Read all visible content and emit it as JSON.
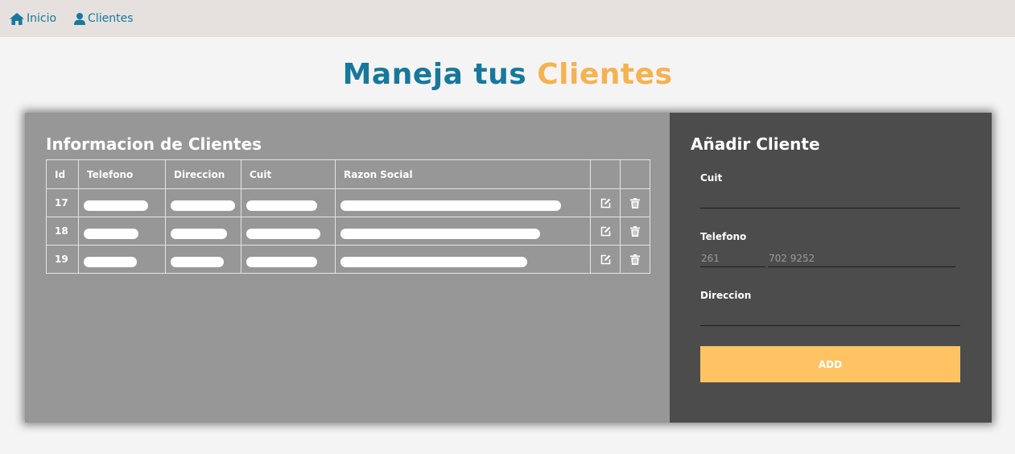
{
  "nav": {
    "items": [
      {
        "label": "Inicio",
        "icon": "home-icon"
      },
      {
        "label": "Clientes",
        "icon": "user-icon"
      }
    ]
  },
  "page": {
    "title_part1": "Maneja tus",
    "title_part2": "Clientes"
  },
  "colors": {
    "accent_blue": "#17789c",
    "accent_orange": "#f5b251",
    "button": "#ffc364",
    "table_panel": "#979797",
    "form_panel": "#4c4c4c"
  },
  "table": {
    "heading": "Informacion de Clientes",
    "columns": [
      "Id",
      "Telefono",
      "Direccion",
      "Cuit",
      "Razon Social",
      "",
      ""
    ],
    "rows": [
      {
        "id": "17",
        "telefono": "",
        "direccion": "",
        "cuit": "",
        "razon_social": "",
        "edit_icon": "edit-icon",
        "delete_icon": "trash-icon"
      },
      {
        "id": "18",
        "telefono": "",
        "direccion": "",
        "cuit": "",
        "razon_social": "",
        "edit_icon": "edit-icon",
        "delete_icon": "trash-icon"
      },
      {
        "id": "19",
        "telefono": "",
        "direccion": "",
        "cuit": "",
        "razon_social": "",
        "edit_icon": "edit-icon",
        "delete_icon": "trash-icon"
      }
    ]
  },
  "form": {
    "heading": "Añadir Cliente",
    "cuit_label": "Cuit",
    "cuit_value": "",
    "telefono_label": "Telefono",
    "telefono_area_placeholder": "261",
    "telefono_number_placeholder": "702 9252",
    "direccion_label": "Direccion",
    "direccion_value": "",
    "add_label": "ADD"
  }
}
